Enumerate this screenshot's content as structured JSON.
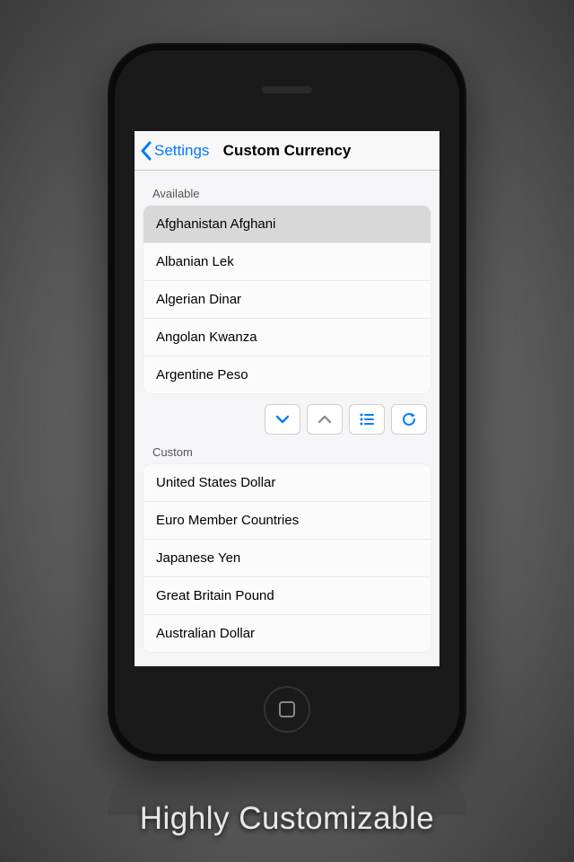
{
  "navbar": {
    "back_label": "Settings",
    "title": "Custom Currency"
  },
  "sections": {
    "available": {
      "label": "Available",
      "items": [
        "Afghanistan Afghani",
        "Albanian Lek",
        "Algerian Dinar",
        "Angolan Kwanza",
        "Argentine Peso"
      ]
    },
    "custom": {
      "label": "Custom",
      "items": [
        "United States Dollar",
        "Euro Member Countries",
        "Japanese Yen",
        "Great Britain Pound",
        "Australian Dollar"
      ]
    }
  },
  "caption": "Highly Customizable",
  "colors": {
    "accent": "#007aff",
    "disabled": "#8e8e93"
  }
}
